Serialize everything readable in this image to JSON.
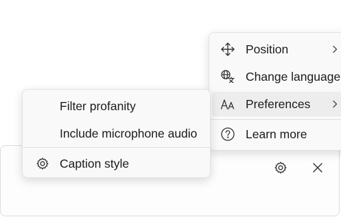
{
  "caption_bar": {
    "settings_icon": "gear-icon",
    "close_icon": "close-icon"
  },
  "main_menu": {
    "items": [
      {
        "label": "Position",
        "icon": "move-arrows-icon",
        "has_submenu": true
      },
      {
        "label": "Change language",
        "icon": "translate-icon",
        "has_submenu": false
      },
      {
        "label": "Preferences",
        "icon": "text-size-icon",
        "has_submenu": true
      },
      {
        "label": "Learn more",
        "icon": "help-circle-icon",
        "has_submenu": false
      }
    ]
  },
  "preferences_submenu": {
    "items": [
      {
        "label": "Filter profanity"
      },
      {
        "label": "Include microphone audio"
      },
      {
        "label": "Caption style",
        "icon": "gear-icon"
      }
    ]
  },
  "colors": {
    "menu_background": "#f9f9f9",
    "hover_background": "#ededed",
    "text": "#1b1b1b"
  }
}
